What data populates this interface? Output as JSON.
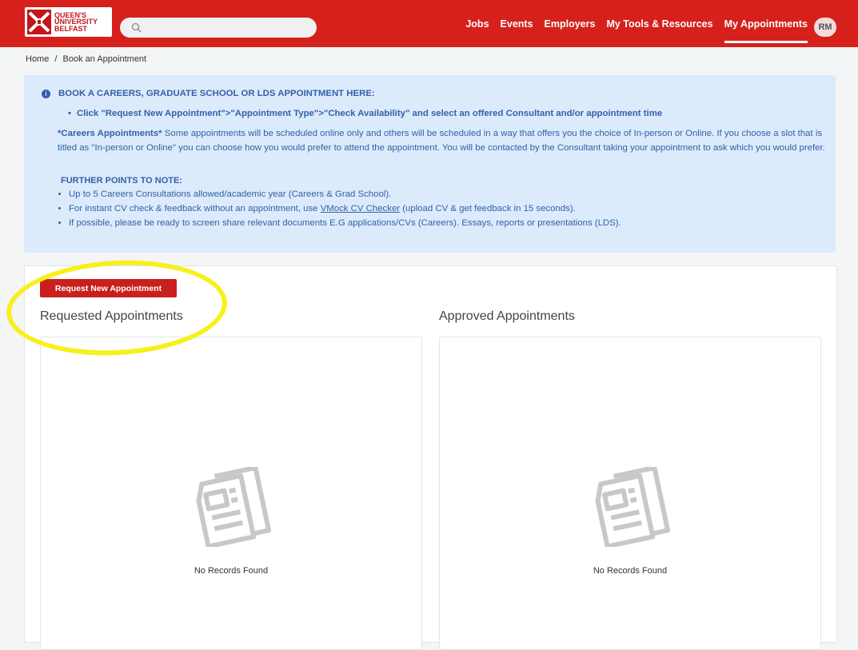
{
  "header": {
    "logo": {
      "line1": "QUEEN'S",
      "line2": "UNIVERSITY",
      "line3": "BELFAST"
    },
    "search": {
      "placeholder": ""
    },
    "nav": [
      {
        "label": "Jobs"
      },
      {
        "label": "Events"
      },
      {
        "label": "Employers"
      },
      {
        "label": "My Tools & Resources"
      },
      {
        "label": "My Appointments",
        "active": true
      }
    ],
    "avatar": "RM"
  },
  "breadcrumb": {
    "home": "Home",
    "separator": "/",
    "current": "Book an Appointment"
  },
  "info": {
    "heading": "BOOK A CAREERS, GRADUATE SCHOOL OR LDS APPOINTMENT HERE:",
    "bullet": "Click \"Request New Appointment\">\"Appointment Type\">\"Check Availability\" and select an offered Consultant and/or appointment time",
    "para_bold": "*Careers Appointments*",
    "para_text": " Some appointments will be scheduled online only and others will be scheduled in a way that offers you the choice of In-person or Online. If you choose a slot that is titled as \"In-person or Online\" you can choose how you would prefer to attend the appointment. You will be contacted by the Consultant taking your appointment to ask which you would prefer.",
    "subheading": "FURTHER POINTS TO NOTE:",
    "points": [
      "Up to 5 Careers Consultations allowed/academic year (Careers & Grad School).",
      "If possible, please be ready to screen share relevant documents E.G applications/CVs (Careers).  Essays, reports or presentations (LDS)."
    ],
    "point2_before": "For instant CV check & feedback without an appointment, use ",
    "point2_link": "VMock CV Checker",
    "point2_after": " (upload CV & get feedback in 15 seconds)."
  },
  "main": {
    "request_button": "Request New Appointment",
    "requested_title": "Requested Appointments",
    "approved_title": "Approved Appointments",
    "empty_text": "No Records Found"
  },
  "colors": {
    "brand": "#d6201c",
    "info_bg": "#dbebfb",
    "info_text": "#3560a8",
    "highlight": "#f7f01a"
  }
}
